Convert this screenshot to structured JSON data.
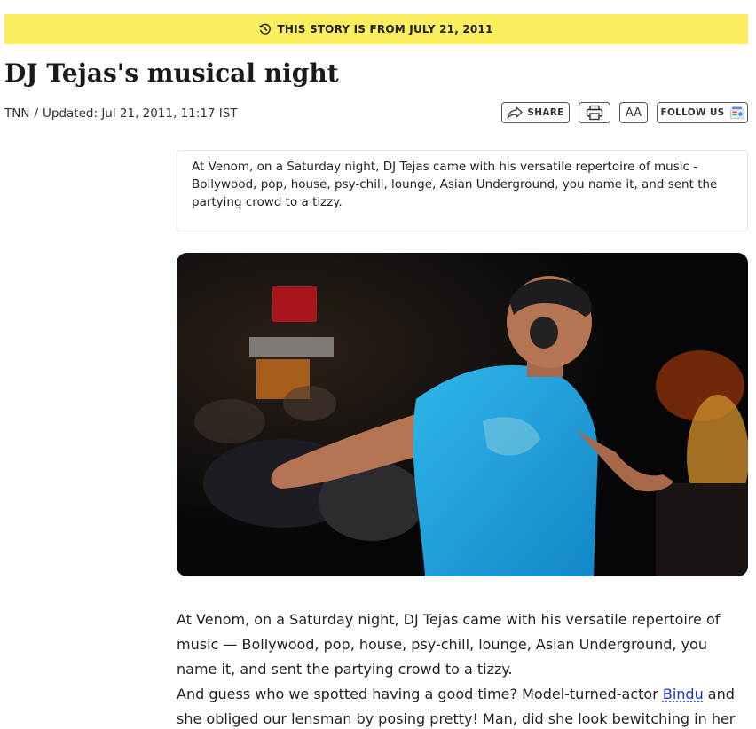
{
  "banner": {
    "text": "THIS STORY IS FROM JULY 21, 2011",
    "icon": "history-clock-icon",
    "color": "#fbef5f"
  },
  "article": {
    "title": "DJ Tejas's musical night",
    "source": "TNN",
    "separator": "/",
    "updated": "Updated: Jul 21, 2011, 11:17 IST",
    "summary": "At Venom, on a Saturday night, DJ Tejas came with his versatile repertoire of music - Bollywood, pop, house, psy-chill, lounge, Asian Underground, you name it, and sent the partying crowd to a tizzy.",
    "image_alt": "DJ Tejas dancing at Venom",
    "paragraph1": "At Venom, on a Saturday night, DJ Tejas came with his versatile repertoire of music — Bollywood, pop, house, psy-chill, lounge, Asian Underground, you name it, and sent the partying crowd to a tizzy.",
    "paragraph2_before": "And guess who we spotted having a good time? Model-turned-actor ",
    "paragraph2_link": "Bindu",
    "paragraph2_after": " and she obliged our lensman by posing pretty! Man, did she look bewitching in her"
  },
  "toolbar": {
    "share_label": "SHARE",
    "share_icon": "share-arrow-icon",
    "print_icon": "printer-icon",
    "font_size_label": "AA",
    "follow_label": "FOLLOW US",
    "follow_icon": "google-news-icon"
  },
  "colors": {
    "link": "#1a2fd6",
    "text": "#222222",
    "border": "#555555"
  }
}
